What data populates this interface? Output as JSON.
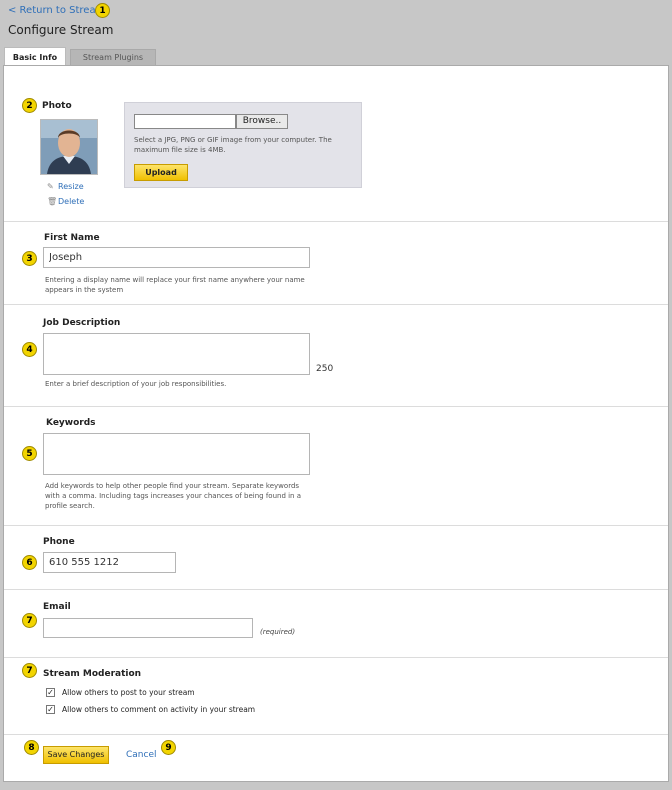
{
  "header": {
    "return_link": "< Return to Stream",
    "page_title": "Configure Stream"
  },
  "tabs": [
    {
      "label": "Basic Info",
      "active": true
    },
    {
      "label": "Stream Plugins",
      "active": false
    }
  ],
  "badges": [
    "1",
    "2",
    "3",
    "4",
    "5",
    "6",
    "7",
    "8",
    "9"
  ],
  "photo": {
    "label": "Photo",
    "resize": "Resize",
    "delete": "Delete",
    "browse_button": "Browse..",
    "upload_help": "Select a JPG, PNG or GIF image from your computer. The maximum file size is 4MB.",
    "upload_button": "Upload"
  },
  "first_name": {
    "label": "First Name",
    "value": "Joseph",
    "help": "Entering a display name will replace your first name anywhere your name appears in the system"
  },
  "job_description": {
    "label": "Job Description",
    "value": "",
    "char_count": "250",
    "help": "Enter a brief description of your job responsibilities."
  },
  "keywords": {
    "label": "Keywords",
    "value": "",
    "help": "Add keywords to help other people find your stream. Separate keywords with a comma. Including tags increases your chances of being found in a profile search."
  },
  "phone": {
    "label": "Phone",
    "value": "610 555 1212"
  },
  "email": {
    "label": "Email",
    "value": "",
    "required_note": "(required)"
  },
  "moderation": {
    "label": "Stream Moderation",
    "options": [
      {
        "label": "Allow others to post to your stream",
        "checked": true
      },
      {
        "label": "Allow others to comment on activity in your stream",
        "checked": true
      }
    ]
  },
  "actions": {
    "save": "Save Changes",
    "cancel": "Cancel"
  },
  "colors": {
    "badge": "#f2d400",
    "link": "#2f6fb8",
    "button": "#f0c000"
  }
}
